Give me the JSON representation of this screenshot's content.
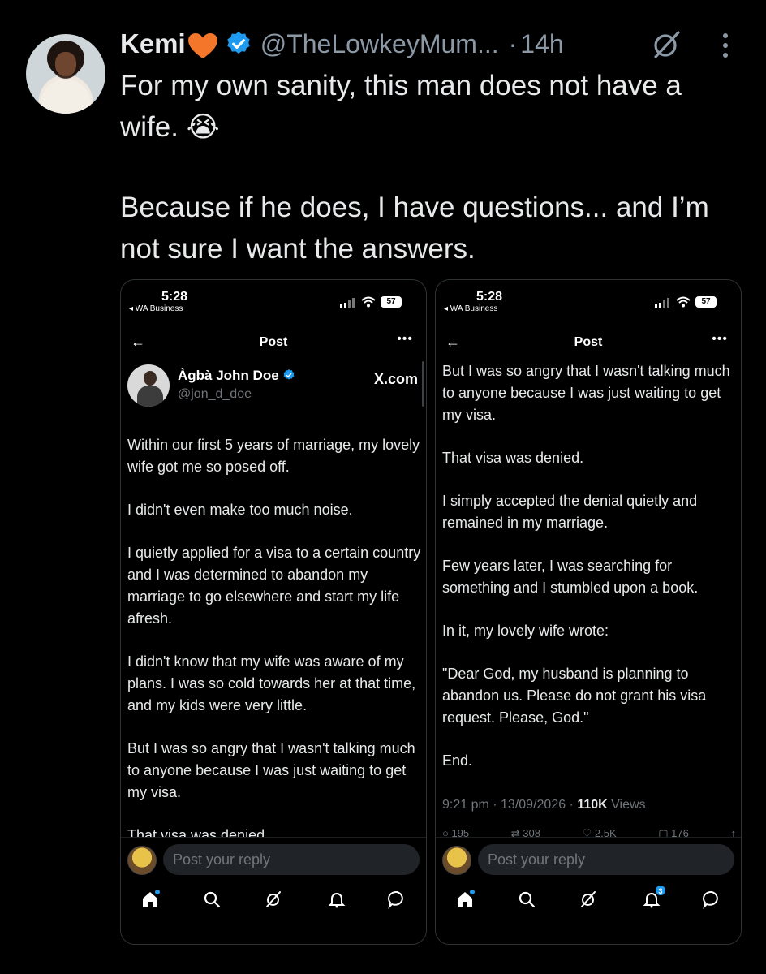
{
  "tweet": {
    "author_name": "Kemi",
    "handle": "@TheLowkeyMum...",
    "separator": "·",
    "time": "14h",
    "text_lines": [
      "For my own sanity, this man does not have a",
      "wife. 😭",
      "Because if he does, I have questions... and I’m",
      "not sure I want the answers."
    ]
  },
  "screenshots": {
    "left": {
      "status_time": "5:28",
      "status_app": "◂ WA Business",
      "battery": "57",
      "header_title": "Post",
      "author_name": "Àgbà John Doe",
      "author_handle": "@jon_d_doe",
      "source": "X.com",
      "paragraphs": [
        "Within our first 5 years of marriage, my lovely wife got me so posed off.",
        "I didn't even make too much noise.",
        "I quietly applied for a visa to a certain country and I was determined to abandon my marriage to go elsewhere and start my life afresh.",
        "I didn't know that my wife was aware of my plans. I was so cold towards her at that time, and my kids were very little.",
        "But I was so angry that I wasn't talking much to anyone because I was just waiting to get my visa.",
        "That visa was denied."
      ],
      "reply_placeholder": "Post your reply"
    },
    "right": {
      "status_time": "5:28",
      "status_app": "◂ WA Business",
      "battery": "57",
      "header_title": "Post",
      "paragraphs": [
        "But I was so angry that I wasn't talking much to anyone because I was just waiting to get my visa.",
        "That visa was denied.",
        "I simply accepted the denial quietly and remained in my marriage.",
        "Few years later, I was searching for something and I stumbled upon a book.",
        "In it, my lovely wife wrote:",
        "\"Dear God, my husband is planning to abandon us. Please do not grant his visa request. Please, God.\"",
        "End."
      ],
      "meta_time": "9:21 pm · 13/09/2026 · ",
      "meta_views_count": "110K",
      "meta_views_label": " Views",
      "engagement": [
        "195",
        "308",
        "2.5K",
        "176"
      ],
      "reply_placeholder": "Post your reply",
      "notification_count": "3"
    }
  },
  "colors": {
    "background": "#000000",
    "text": "#e7e9ea",
    "secondary": "#8b98a5",
    "accent": "#1d9bf0",
    "heart": "#f4762a"
  },
  "icons": [
    "orange-heart-icon",
    "verified-badge-icon",
    "grok-icon",
    "more-icon",
    "back-arrow-icon",
    "home-icon",
    "search-icon",
    "bell-icon",
    "messages-icon"
  ]
}
